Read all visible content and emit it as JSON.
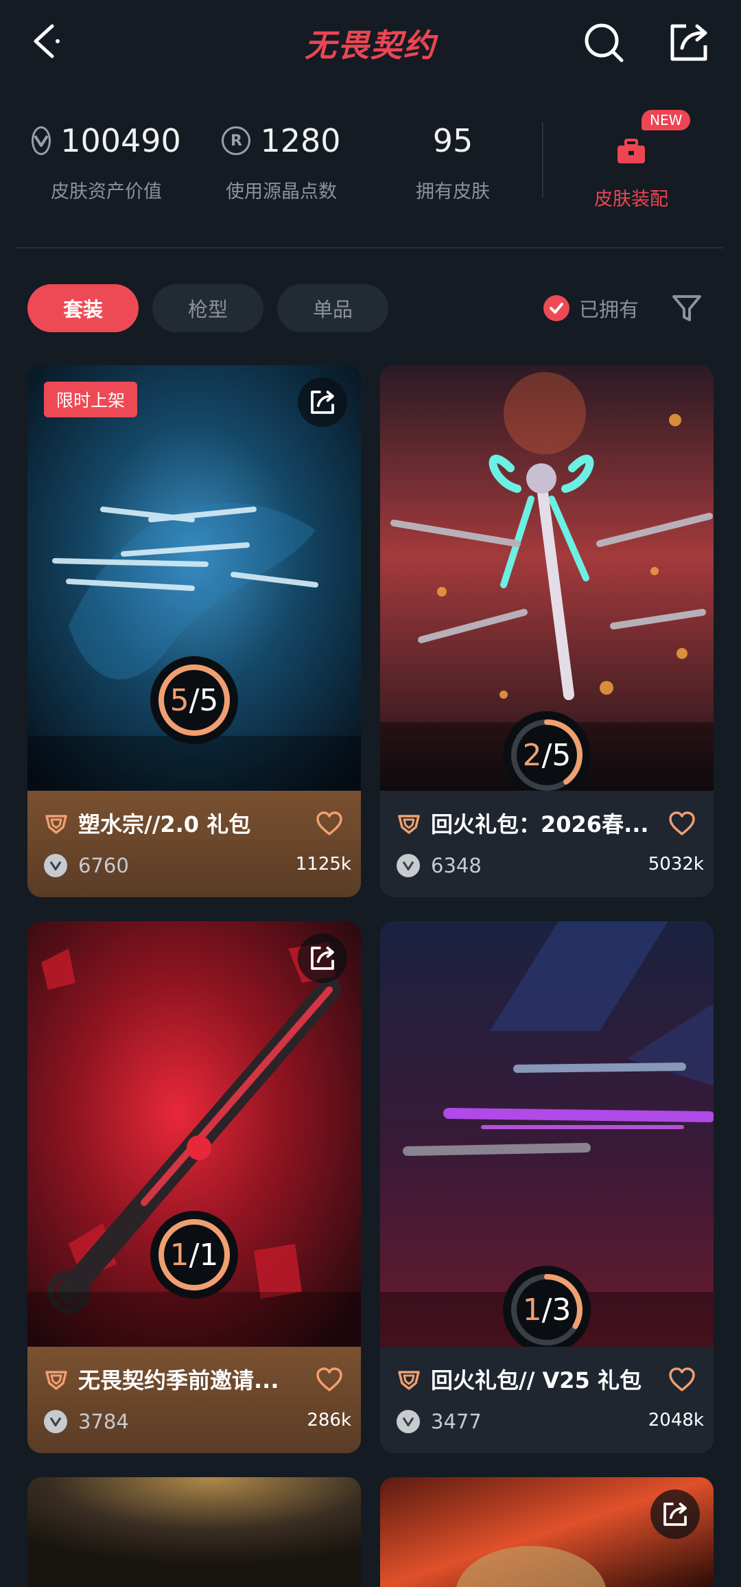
{
  "header": {
    "title": "无畏契约"
  },
  "stats": [
    {
      "value": "100490",
      "label": "皮肤资产价值",
      "icon": "vp-coin-icon"
    },
    {
      "value": "1280",
      "label": "使用源晶点数",
      "icon": "radianite-coin-icon",
      "glyph": "R"
    },
    {
      "value": "95",
      "label": "拥有皮肤"
    }
  ],
  "equip": {
    "badge": "NEW",
    "label": "皮肤装配"
  },
  "tabs": [
    "套装",
    "枪型",
    "单品"
  ],
  "active_tab": 0,
  "owned_filter": {
    "label": "已拥有",
    "checked": true
  },
  "accent": "#ee4a55",
  "cards": [
    {
      "tag": "限时上架",
      "progress_text": "5/5",
      "owned": 5,
      "total": 5,
      "title": "塑水宗//2.0 礼包",
      "price": "6760",
      "likes": "1125k",
      "theme": "warm"
    },
    {
      "progress_text": "2/5",
      "owned": 2,
      "total": 5,
      "title": "回火礼包：2026春...",
      "price": "6348",
      "likes": "5032k",
      "theme": "cool"
    },
    {
      "progress_text": "1/1",
      "owned": 1,
      "total": 1,
      "title": "无畏契约季前邀请...",
      "price": "3784",
      "likes": "286k",
      "theme": "warm"
    },
    {
      "progress_text": "1/3",
      "owned": 1,
      "total": 3,
      "title": "回火礼包// V25 礼包",
      "price": "3477",
      "likes": "2048k",
      "theme": "cool"
    }
  ]
}
